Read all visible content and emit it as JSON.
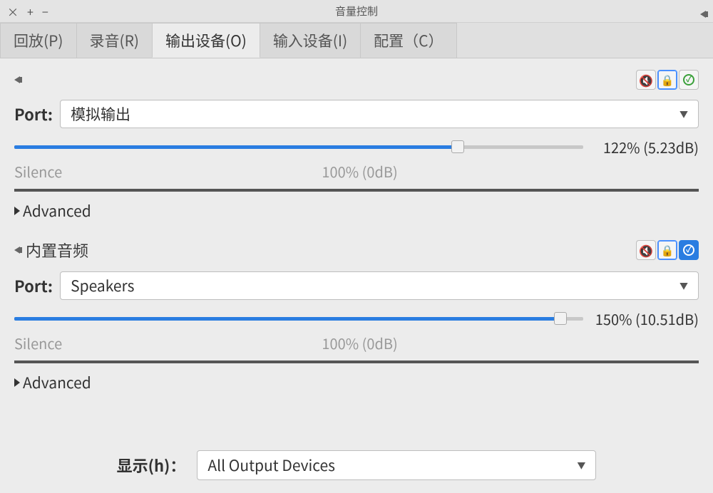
{
  "window": {
    "title": "音量控制"
  },
  "tabs": [
    {
      "label": "回放(P)"
    },
    {
      "label": "录音(R)"
    },
    {
      "label": "输出设备(O)",
      "active": true
    },
    {
      "label": "输入设备(I)"
    },
    {
      "label": "配置（C）"
    }
  ],
  "devices": [
    {
      "name": "",
      "port_label": "Port:",
      "port_value": "模拟输出",
      "volume_percent": 122,
      "volume_fill_percent": 78,
      "volume_text": "122% (5.23dB)",
      "silence_label": "Silence",
      "center_label": "100% (0dB)",
      "advanced_label": "Advanced",
      "is_default": false
    },
    {
      "name": "内置音频",
      "port_label": "Port:",
      "port_value": "Speakers",
      "volume_percent": 150,
      "volume_fill_percent": 96,
      "volume_text": "150% (10.51dB)",
      "silence_label": "Silence",
      "center_label": "100% (0dB)",
      "advanced_label": "Advanced",
      "is_default": true
    }
  ],
  "footer": {
    "label": "显示(h)：",
    "value": "All Output Devices"
  },
  "icons": {
    "mute": "🔇",
    "lock": "🔒"
  }
}
